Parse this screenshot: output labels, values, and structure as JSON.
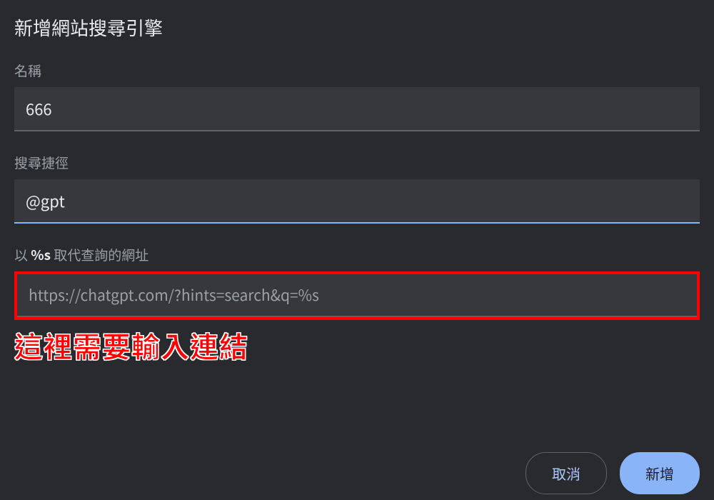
{
  "dialog": {
    "title": "新增網站搜尋引擎"
  },
  "fields": {
    "name": {
      "label": "名稱",
      "value": "666"
    },
    "shortcut": {
      "label": "搜尋捷徑",
      "value": "@gpt"
    },
    "url": {
      "label_prefix": "以 ",
      "label_bold": "%s",
      "label_suffix": " 取代查詢的網址",
      "value": "https://chatgpt.com/?hints=search&q=%s"
    }
  },
  "annotation": {
    "text": "這裡需要輸入連結"
  },
  "buttons": {
    "cancel": "取消",
    "add": "新增"
  }
}
